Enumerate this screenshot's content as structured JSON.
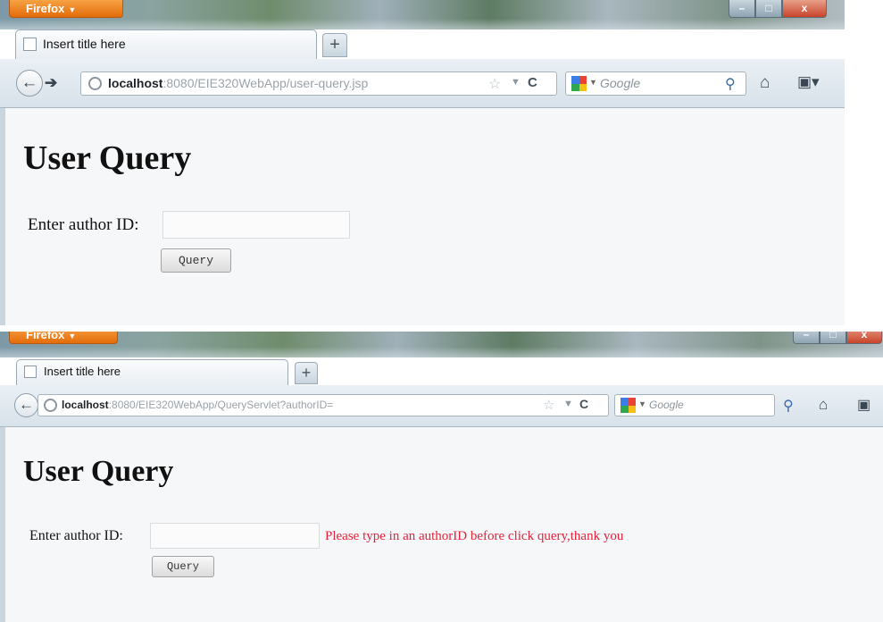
{
  "browser": {
    "app_button_label": "Firefox",
    "tab_title": "Insert title here",
    "new_tab_label": "+",
    "search_engine": "Google"
  },
  "screenshot1": {
    "url_host": "localhost",
    "url_rest": ":8080/EIE320WebApp/user-query.jsp",
    "heading": "User Query",
    "author_label": "Enter author ID:",
    "author_value": "",
    "query_button": "Query"
  },
  "screenshot2": {
    "url_host": "localhost",
    "url_rest": ":8080/EIE320WebApp/QueryServlet?authorID=",
    "heading": "User Query",
    "author_label": "Enter author ID:",
    "author_value": "",
    "query_button": "Query",
    "error_message": "Please type in an authorID before click query,thank you"
  },
  "icons": [
    "firefox-menu-icon",
    "page-favicon-icon",
    "back-arrow-icon",
    "forward-arrow-icon",
    "site-identity-icon",
    "bookmark-star-icon",
    "history-dropdown-icon",
    "reload-icon",
    "google-icon",
    "search-magnifier-icon",
    "home-icon",
    "bookmarks-menu-icon",
    "minimize-icon",
    "maximize-icon",
    "close-icon"
  ],
  "colors": {
    "error": "#e8213a",
    "firefox_button": "#e46c0a"
  }
}
